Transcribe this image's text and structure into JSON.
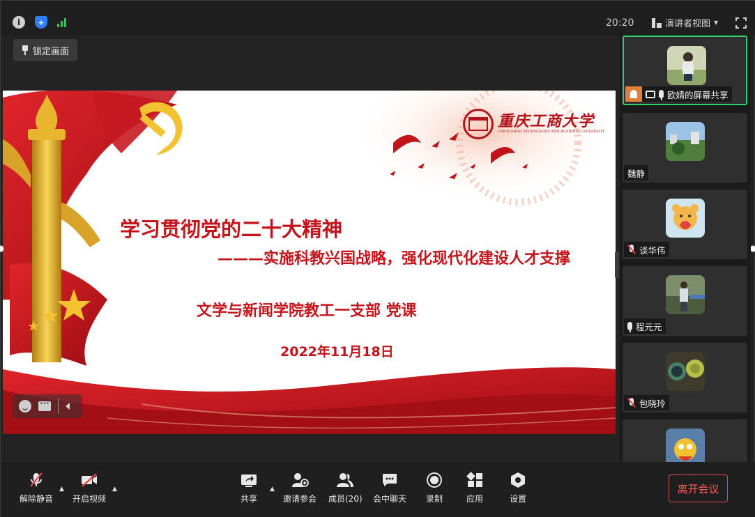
{
  "topbar": {
    "icons": [
      "info-icon",
      "shield-icon",
      "signal-icon"
    ],
    "clock": "20:20",
    "view_mode": "演讲者视图",
    "fullscreen_icon": "fullscreen-icon"
  },
  "lock_button": {
    "label": "锁定画面",
    "icon": "pin-icon"
  },
  "slide": {
    "title": "学习贯彻党的二十大精神",
    "subtitle": "———实施科教兴国战略，强化现代化建设人才支撑",
    "branch": "文学与新闻学院教工一支部  党课",
    "date": "2022年11月18日",
    "university_name": "重庆工商大学",
    "university_name_en": "CHONGQING TECHNOLOGY AND BUSINESS UNIVERSITY",
    "accent_color": "#c4141b"
  },
  "reactions": {
    "icons": [
      "emoji-icon",
      "chat-bubble-icon",
      "collapse-icon"
    ]
  },
  "gallery": {
    "participants": [
      {
        "name": "欧婧的屏幕共享",
        "status": "screen-share",
        "mic": "on",
        "active": true
      },
      {
        "name": "魏静",
        "status": "video",
        "mic": "none",
        "active": false
      },
      {
        "name": "谈华伟",
        "status": "video",
        "mic": "muted",
        "active": false
      },
      {
        "name": "程元元",
        "status": "video",
        "mic": "on",
        "active": false
      },
      {
        "name": "包晓玲",
        "status": "video",
        "mic": "muted",
        "active": false
      },
      {
        "name": "",
        "status": "video",
        "mic": "none",
        "active": false
      }
    ]
  },
  "toolbar": {
    "unmute": "解除静音",
    "start_video": "开启视频",
    "share": "共享",
    "invite": "邀请参会",
    "members": "成员(20)",
    "chat": "会中聊天",
    "record": "录制",
    "apps": "应用",
    "settings": "设置",
    "leave": "离开会议",
    "leave_color": "#e34b4b"
  }
}
